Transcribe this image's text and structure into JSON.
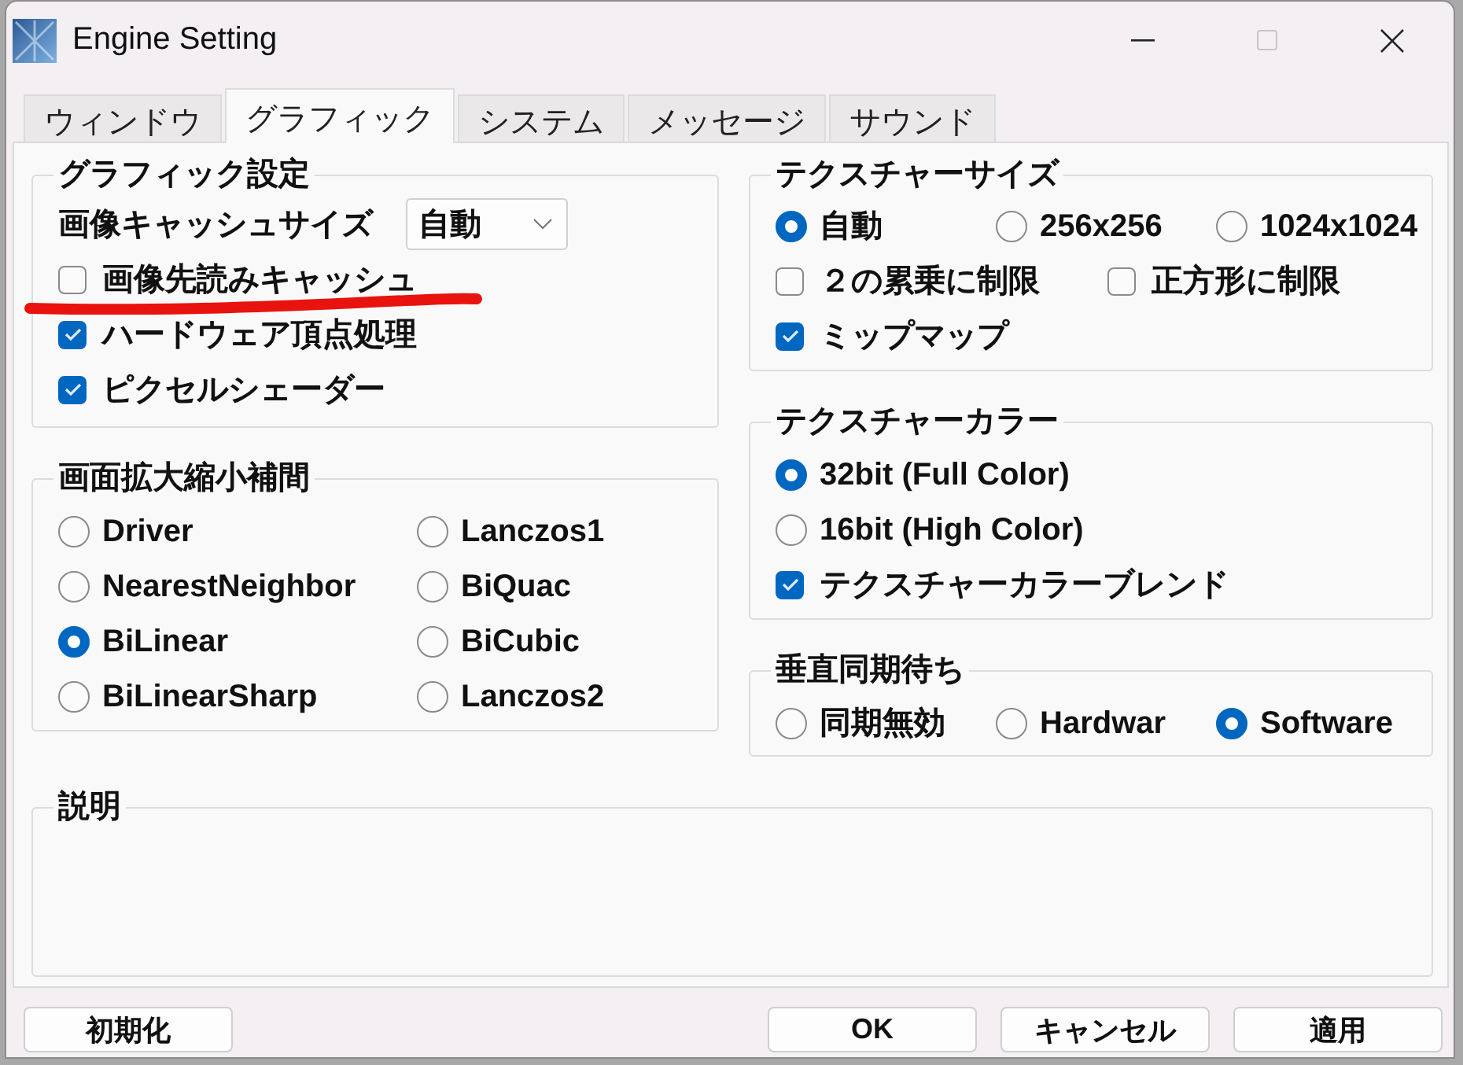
{
  "window": {
    "title": "Engine Setting",
    "maximize": {
      "disabled": true
    }
  },
  "tabs": [
    {
      "label": "ウィンドウ",
      "selected": false
    },
    {
      "label": "グラフィック",
      "selected": true
    },
    {
      "label": "システム",
      "selected": false
    },
    {
      "label": "メッセージ",
      "selected": false
    },
    {
      "label": "サウンド",
      "selected": false
    }
  ],
  "graphics": {
    "title": "グラフィック設定",
    "cache_size": {
      "label": "画像キャッシュサイズ",
      "value": "自動"
    },
    "options": [
      {
        "label": "画像先読みキャッシュ",
        "checked": false,
        "underlined": true
      },
      {
        "label": "ハードウェア頂点処理",
        "checked": true,
        "underlined": false
      },
      {
        "label": "ピクセルシェーダー",
        "checked": true,
        "underlined": false
      }
    ]
  },
  "scaling": {
    "title": "画面拡大縮小補間",
    "options": [
      {
        "label": "Driver",
        "selected": false
      },
      {
        "label": "Lanczos1",
        "selected": false
      },
      {
        "label": "NearestNeighbor",
        "selected": false
      },
      {
        "label": "BiQuac",
        "selected": false
      },
      {
        "label": "BiLinear",
        "selected": true
      },
      {
        "label": "BiCubic",
        "selected": false
      },
      {
        "label": "BiLinearSharp",
        "selected": false
      },
      {
        "label": "Lanczos2",
        "selected": false
      }
    ]
  },
  "texture_size": {
    "title": "テクスチャーサイズ",
    "sizes": [
      {
        "label": "自動",
        "selected": true
      },
      {
        "label": "256x256",
        "selected": false
      },
      {
        "label": "1024x1024",
        "selected": false
      }
    ],
    "options": [
      {
        "label": "２の累乗に制限",
        "checked": false
      },
      {
        "label": "正方形に制限",
        "checked": false
      },
      {
        "label": "ミップマップ",
        "checked": true
      }
    ]
  },
  "texture_color": {
    "title": "テクスチャーカラー",
    "modes": [
      {
        "label": "32bit (Full Color)",
        "selected": true
      },
      {
        "label": "16bit (High Color)",
        "selected": false
      }
    ],
    "options": [
      {
        "label": "テクスチャーカラーブレンド",
        "checked": true
      }
    ]
  },
  "vsync": {
    "title": "垂直同期待ち",
    "modes": [
      {
        "label": "同期無効",
        "selected": false
      },
      {
        "label": "Hardwar",
        "selected": false
      },
      {
        "label": "Software",
        "selected": true
      }
    ]
  },
  "description": {
    "title": "説明"
  },
  "footer": {
    "reset_button": "初期化",
    "buttons": [
      "OK",
      "キャンセル",
      "適用"
    ]
  }
}
